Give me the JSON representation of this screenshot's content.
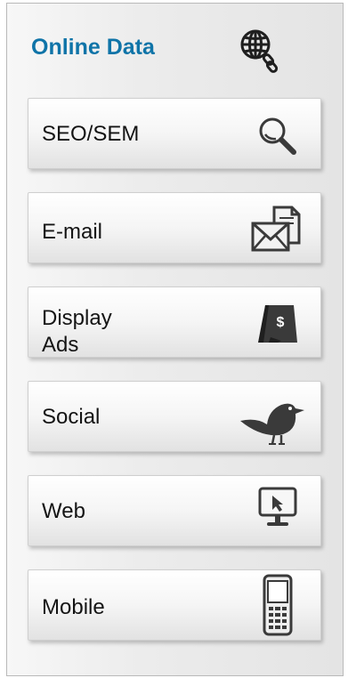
{
  "panel": {
    "title": "Online Data",
    "title_color": "#0f74a8",
    "title_icon": "globe-link-icon"
  },
  "cards": [
    {
      "label": "SEO/SEM",
      "icon": "magnifier-icon"
    },
    {
      "label": "E-mail",
      "icon": "envelope-document-icon"
    },
    {
      "label": "Display Ads",
      "icon": "sandwich-board-sign-icon"
    },
    {
      "label": "Social",
      "icon": "bird-icon"
    },
    {
      "label": "Web",
      "icon": "monitor-cursor-icon"
    },
    {
      "label": "Mobile",
      "icon": "mobile-phone-icon"
    }
  ],
  "colors": {
    "icon": "#3a3a3a",
    "card_border": "#cfcfcf",
    "panel_border": "#b9b9b9"
  }
}
